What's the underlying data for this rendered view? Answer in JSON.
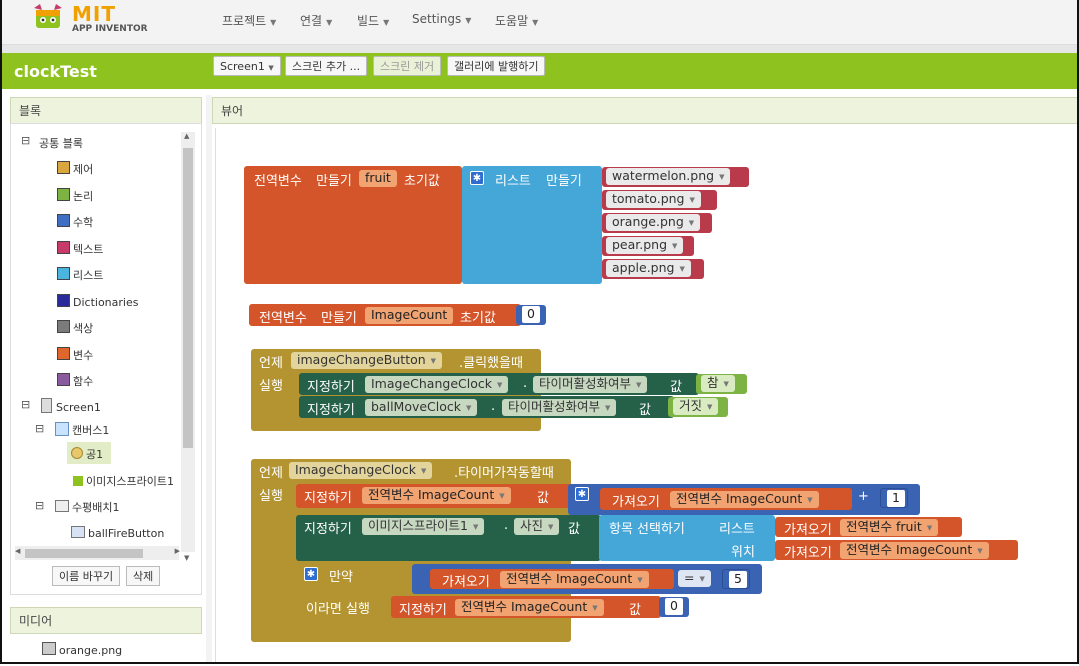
{
  "header": {
    "logo_title": "MIT",
    "logo_subtitle": "APP INVENTOR",
    "menu": [
      {
        "label": "프로젝트"
      },
      {
        "label": "연결"
      },
      {
        "label": "빌드"
      },
      {
        "label": "Settings"
      },
      {
        "label": "도움말"
      }
    ]
  },
  "project": {
    "name": "clockTest",
    "screen_select": "Screen1",
    "add_screen": "스크린 추가 ...",
    "remove_screen": "스크린 제거",
    "publish": "갤러리에 발행하기"
  },
  "blocks_panel": {
    "title": "블록",
    "builtin": "공통 블록",
    "categories": [
      {
        "label": "제어",
        "color": "#d9a63f"
      },
      {
        "label": "논리",
        "color": "#7cb342"
      },
      {
        "label": "수학",
        "color": "#3f6fc4"
      },
      {
        "label": "텍스트",
        "color": "#c73b6a"
      },
      {
        "label": "리스트",
        "color": "#4bb5e0"
      },
      {
        "label": "Dictionaries",
        "color": "#2b2a9b"
      },
      {
        "label": "색상",
        "color": "#7b7b7b"
      },
      {
        "label": "변수",
        "color": "#e0662c"
      },
      {
        "label": "함수",
        "color": "#8a5a9e"
      }
    ],
    "screen": "Screen1",
    "canvas": "캔버스1",
    "ball": "공1",
    "image_sprite": "이미지스프라이트1",
    "horizontal": "수평배치1",
    "ball_fire": "ballFireButton",
    "rename_button": "이름 바꾸기",
    "delete_button": "삭제"
  },
  "media_panel": {
    "title": "미디어",
    "items": [
      "orange.png"
    ]
  },
  "viewer": {
    "title": "뷰어",
    "b1": {
      "global": "전역변수",
      "make": "만들기",
      "var": "fruit",
      "init": "초기값",
      "list_label": "리스트",
      "list_make": "만들기",
      "items": [
        "watermelon.png",
        "tomato.png",
        "orange.png",
        "pear.png",
        "apple.png"
      ]
    },
    "b2": {
      "global": "전역변수",
      "make": "만들기",
      "var": "ImageCount",
      "init": "초기값",
      "value": "0"
    },
    "b3": {
      "when": "언제",
      "component": "imageChangeButton",
      "event": ".클릭했을때",
      "do": "실행",
      "set": "지정하기",
      "c1": "ImageChangeClock",
      "dot": ".",
      "p1": "타이머활성화여부",
      "to": "값",
      "v1": "참",
      "c2": "ballMoveClock",
      "p2": "타이머활성화여부",
      "v2": "거짓"
    },
    "b4": {
      "when": "언제",
      "component": "ImageChangeClock",
      "event": ".타이머가작동할때",
      "do": "실행",
      "set": "지정하기",
      "global_var": "전역변수 ImageCount",
      "to": "값",
      "get": "가져오기",
      "plus": "+",
      "one": "1",
      "sprite": "이미지스프라이트1",
      "dot": ".",
      "pic": "사진",
      "select": "항목 선택하기",
      "list": "리스트",
      "fruit": "전역변수 fruit",
      "index": "위치",
      "if": "만약",
      "eq": "=",
      "five": "5",
      "then": "이라면 실행",
      "zero": "0"
    }
  }
}
